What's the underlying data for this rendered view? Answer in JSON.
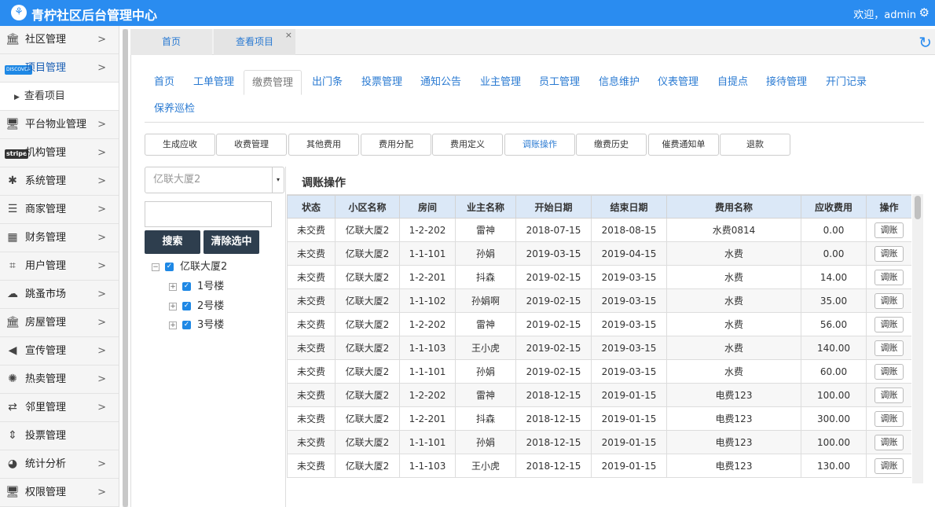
{
  "header": {
    "logo_glyph": "⚘",
    "title": "青柠社区后台管理中心",
    "welcome": "欢迎，admin",
    "gear_icon": "⚙"
  },
  "sidebar": {
    "items": [
      {
        "icon": "🏛",
        "label": "社区管理",
        "chevron": ">"
      },
      {
        "icon": "DISCOVER",
        "label": "项目管理",
        "chevron": ">"
      },
      {
        "icon": "🖥",
        "label": "平台物业管理",
        "chevron": ">"
      },
      {
        "icon": "stripe",
        "label": "机构管理",
        "chevron": ">"
      },
      {
        "icon": "✱",
        "label": "系统管理",
        "chevron": ">"
      },
      {
        "icon": "☰",
        "label": "商家管理",
        "chevron": ">"
      },
      {
        "icon": "▦",
        "label": "财务管理",
        "chevron": ">"
      },
      {
        "icon": "⌗",
        "label": "用户管理",
        "chevron": ">"
      },
      {
        "icon": "☁",
        "label": "跳蚤市场",
        "chevron": ">"
      },
      {
        "icon": "🏛",
        "label": "房屋管理",
        "chevron": ">"
      },
      {
        "icon": "◀",
        "label": "宣传管理",
        "chevron": ">"
      },
      {
        "icon": "✺",
        "label": "热卖管理",
        "chevron": ">"
      },
      {
        "icon": "⇄",
        "label": "邻里管理",
        "chevron": ">"
      },
      {
        "icon": "⇕",
        "label": "投票管理",
        "chevron": ""
      },
      {
        "icon": "◕",
        "label": "统计分析",
        "chevron": ">"
      },
      {
        "icon": "🖥",
        "label": "权限管理",
        "chevron": ">"
      }
    ],
    "sub_item": "查看项目"
  },
  "top_tabs": {
    "home": "首页",
    "current": "查看项目",
    "close": "×",
    "refresh_icon": "↻"
  },
  "nav2": [
    "首页",
    "工单管理",
    "缴费管理",
    "出门条",
    "投票管理",
    "通知公告",
    "业主管理",
    "员工管理",
    "信息维护",
    "仪表管理",
    "自提点",
    "接待管理",
    "开门记录",
    "保养巡检"
  ],
  "fee_buttons": [
    "生成应收",
    "收费管理",
    "其他费用",
    "费用分配",
    "费用定义",
    "调账操作",
    "缴费历史",
    "催费通知单",
    "退款"
  ],
  "left_panel": {
    "select_value": "亿联大厦2",
    "select_caret": "▾",
    "search_button": "搜索",
    "clear_button": "清除选中",
    "tree": {
      "root": {
        "toggle": "−",
        "check": "✓",
        "label": "亿联大厦2"
      },
      "children": [
        {
          "toggle": "+",
          "check": "✓",
          "label": "1号楼"
        },
        {
          "toggle": "+",
          "check": "✓",
          "label": "2号楼"
        },
        {
          "toggle": "+",
          "check": "✓",
          "label": "3号楼"
        }
      ]
    }
  },
  "panel_title": "调账操作",
  "table": {
    "headers": [
      "状态",
      "小区名称",
      "房间",
      "业主名称",
      "开始日期",
      "结束日期",
      "费用名称",
      "应收费用",
      "操作"
    ],
    "rows": [
      [
        "未交费",
        "亿联大厦2",
        "1-2-202",
        "雷神",
        "2018-07-15",
        "2018-08-15",
        "水费0814",
        "0.00",
        "调账"
      ],
      [
        "未交费",
        "亿联大厦2",
        "1-1-101",
        "孙娟",
        "2019-03-15",
        "2019-04-15",
        "水费",
        "0.00",
        "调账"
      ],
      [
        "未交费",
        "亿联大厦2",
        "1-2-201",
        "抖森",
        "2019-02-15",
        "2019-03-15",
        "水费",
        "14.00",
        "调账"
      ],
      [
        "未交费",
        "亿联大厦2",
        "1-1-102",
        "孙娟啊",
        "2019-02-15",
        "2019-03-15",
        "水费",
        "35.00",
        "调账"
      ],
      [
        "未交费",
        "亿联大厦2",
        "1-2-202",
        "雷神",
        "2019-02-15",
        "2019-03-15",
        "水费",
        "56.00",
        "调账"
      ],
      [
        "未交费",
        "亿联大厦2",
        "1-1-103",
        "王小虎",
        "2019-02-15",
        "2019-03-15",
        "水费",
        "140.00",
        "调账"
      ],
      [
        "未交费",
        "亿联大厦2",
        "1-1-101",
        "孙娟",
        "2019-02-15",
        "2019-03-15",
        "水费",
        "60.00",
        "调账"
      ],
      [
        "未交费",
        "亿联大厦2",
        "1-2-202",
        "雷神",
        "2018-12-15",
        "2019-01-15",
        "电费123",
        "100.00",
        "调账"
      ],
      [
        "未交费",
        "亿联大厦2",
        "1-2-201",
        "抖森",
        "2018-12-15",
        "2019-01-15",
        "电费123",
        "300.00",
        "调账"
      ],
      [
        "未交费",
        "亿联大厦2",
        "1-1-101",
        "孙娟",
        "2018-12-15",
        "2019-01-15",
        "电费123",
        "100.00",
        "调账"
      ],
      [
        "未交费",
        "亿联大厦2",
        "1-1-103",
        "王小虎",
        "2018-12-15",
        "2019-01-15",
        "电费123",
        "130.00",
        "调账"
      ]
    ]
  }
}
